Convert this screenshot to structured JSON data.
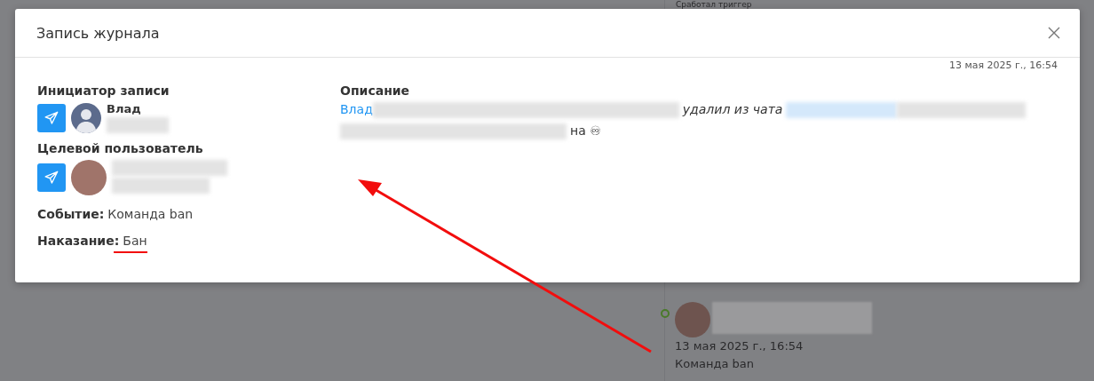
{
  "background": {
    "heading": "Сработал триггер",
    "entry": {
      "date": "13 мая 2025 г., 16:54",
      "event": "Команда ban"
    }
  },
  "dialog": {
    "title": "Запись журнала",
    "timestamp": "13 мая 2025 г., 16:54",
    "initiator": {
      "heading": "Инициатор записи",
      "name": "Влад"
    },
    "target": {
      "heading": "Целевой пользователь"
    },
    "fields": [
      {
        "label": "Событие:",
        "value": "Команда ban"
      },
      {
        "label": "Наказание:",
        "value": "Бан"
      }
    ],
    "description": {
      "heading": "Описание",
      "author": "Влад",
      "action": "удалил из чата",
      "suffix": "на ♾"
    }
  }
}
